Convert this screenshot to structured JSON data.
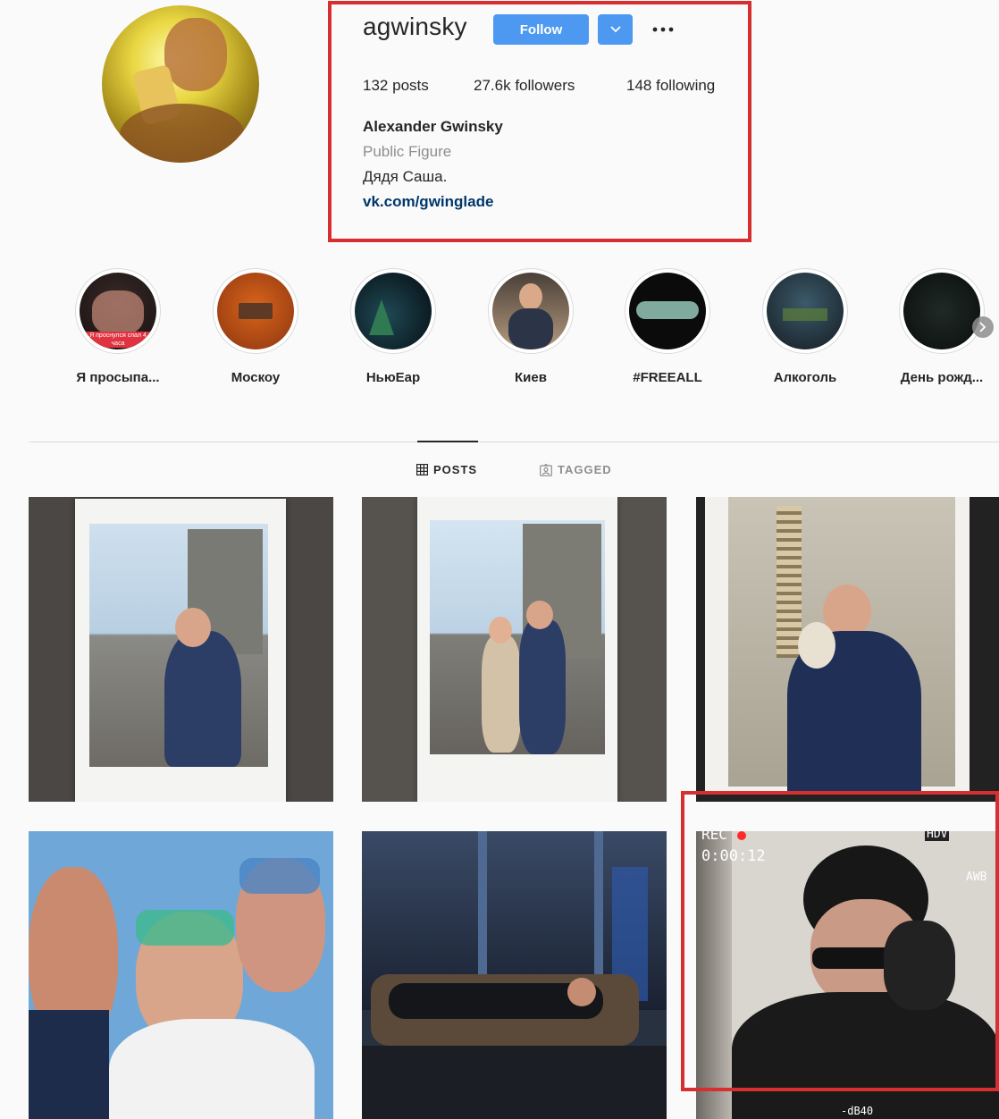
{
  "profile": {
    "username": "agwinsky",
    "follow_label": "Follow",
    "stats": {
      "posts": "132",
      "posts_label": "posts",
      "followers": "27.6k",
      "followers_label": "followers",
      "following": "148",
      "following_label": "following"
    },
    "full_name": "Alexander Gwinsky",
    "category": "Public Figure",
    "bio": "Дядя Саша.",
    "link": "vk.com/gwinglade"
  },
  "highlights": [
    {
      "label": "Я просыпа..."
    },
    {
      "label": "Москоу"
    },
    {
      "label": "НьюЕар"
    },
    {
      "label": "Киев"
    },
    {
      "label": "#FREEALL"
    },
    {
      "label": "Алкоголь"
    },
    {
      "label": "День рожд..."
    }
  ],
  "highlight_overlay_text": "Я проснулся спал 4 часа",
  "tabs": {
    "posts": "POSTS",
    "tagged": "TAGGED"
  },
  "posts_overlays": {
    "video_timer": "0:00:12",
    "video_rec": "REC",
    "video_hd": "HDV",
    "video_db": "-dB40",
    "video_awb": "AWB"
  },
  "colors": {
    "accent": "#4d98f0",
    "annotation": "#d72f2f",
    "link": "#00376b"
  },
  "icons": [
    "chevron-down-icon",
    "more-dots-icon",
    "grid-icon",
    "tagged-icon",
    "chevron-right-icon"
  ]
}
